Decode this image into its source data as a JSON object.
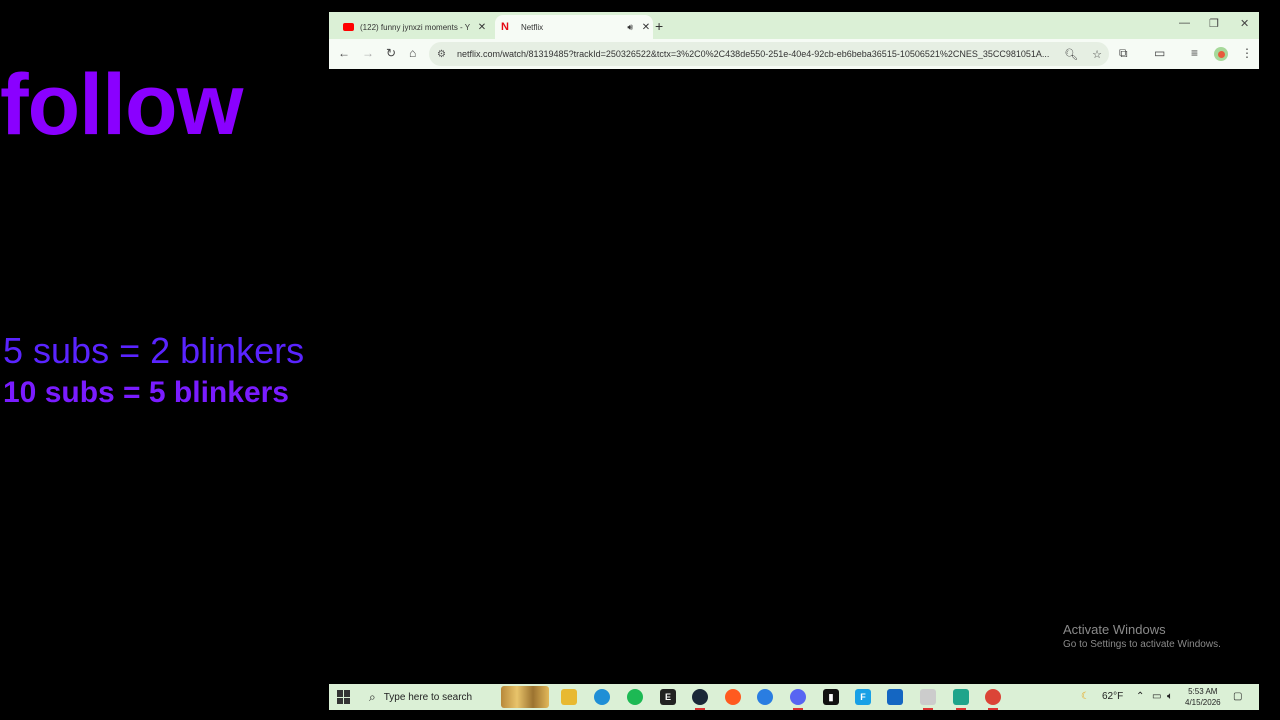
{
  "overlay": {
    "follow": "follow",
    "line1": "5 subs = 2 blinkers",
    "line2": "10 subs = 5 blinkers"
  },
  "browser": {
    "tabs": [
      {
        "title": "(122) funny jynxzi moments - Y",
        "favicon": "youtube-icon",
        "active": false
      },
      {
        "title": "Netflix",
        "favicon": "netflix-icon",
        "active": true
      }
    ],
    "new_tab_label": "+",
    "url": "netflix.com/watch/81319485?trackId=250326522&tctx=3%2C0%2C438de550-251e-40e4-92cb-eb6beba36515-10506521%2CNES_35CC981051A..."
  },
  "watermark": {
    "title": "Activate Windows",
    "subtitle": "Go to Settings to activate Windows."
  },
  "taskbar": {
    "search_placeholder": "Type here to search",
    "weather": "62°F",
    "time": "5:53 AM",
    "date": "4/15/2026",
    "apps": [
      "file-explorer",
      "edge",
      "spotify",
      "epic-games",
      "steam",
      "app-orange",
      "app-blue",
      "discord",
      "app-dark",
      "app-cyan",
      "app-blue2",
      "app-files",
      "app-teal",
      "chrome"
    ]
  },
  "colors": {
    "follow": "#8a00ff",
    "line1": "#5a24ff",
    "line2": "#7a1cff",
    "chrome_frame": "#dbf0d6"
  }
}
